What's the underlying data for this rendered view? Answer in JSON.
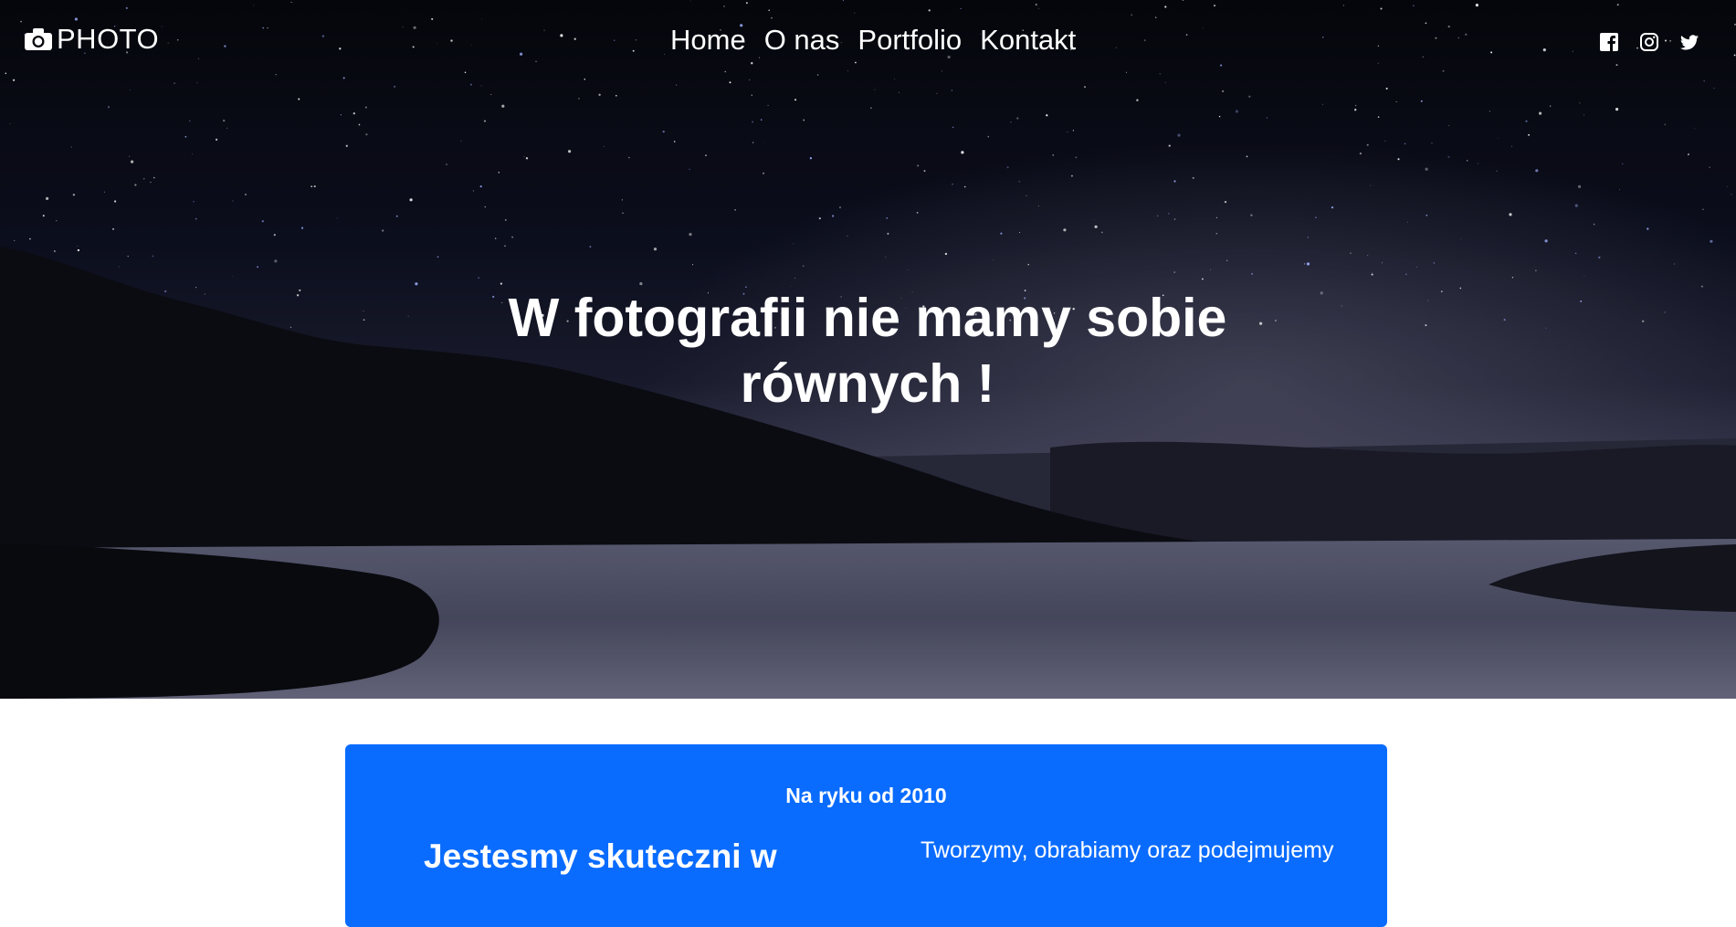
{
  "header": {
    "brand_label": "PHOTO",
    "brand_icon": "camera-icon",
    "nav": [
      "Home",
      "O nas",
      "Portfolio",
      "Kontakt"
    ],
    "social": [
      "facebook-icon",
      "instagram-icon",
      "twitter-icon"
    ]
  },
  "hero": {
    "heading_line1": "W fotografii nie mamy sobie",
    "heading_line2": "równych !"
  },
  "intro": {
    "since": "Na ryku od 2010",
    "title": "Jestesmy skuteczni w",
    "text": "Tworzymy, obrabiamy oraz podejmujemy"
  },
  "colors": {
    "accent": "#0a6cff",
    "text_light": "#ffffff",
    "sky_dark": "#06070c"
  }
}
